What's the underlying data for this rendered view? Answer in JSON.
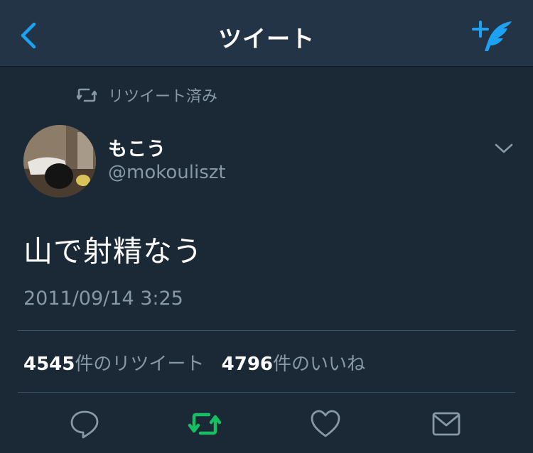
{
  "colors": {
    "background": "#1b2836",
    "navbar": "#243447",
    "accent_blue": "#1da1f2",
    "retweet_green": "#17bf63",
    "secondary_text": "#8899a6"
  },
  "navbar": {
    "title": "ツイート",
    "back_icon": "chevron-left-icon",
    "compose_icon": "compose-tweet-icon"
  },
  "retweet_context": {
    "icon": "retweet-icon",
    "text": "リツイート済み"
  },
  "tweet": {
    "author": {
      "display_name": "もこう",
      "handle": "@mokouliszt"
    },
    "text": "山で射精なう",
    "timestamp": "2011/09/14 3:25"
  },
  "stats": {
    "retweets": {
      "count": "4545",
      "label": "件のリツイート"
    },
    "likes": {
      "count": "4796",
      "label": "件のいいね"
    }
  },
  "actions": {
    "reply_icon": "reply-icon",
    "retweet_icon": "retweet-icon",
    "retweet_state": "active",
    "like_icon": "heart-icon",
    "dm_icon": "envelope-icon"
  }
}
